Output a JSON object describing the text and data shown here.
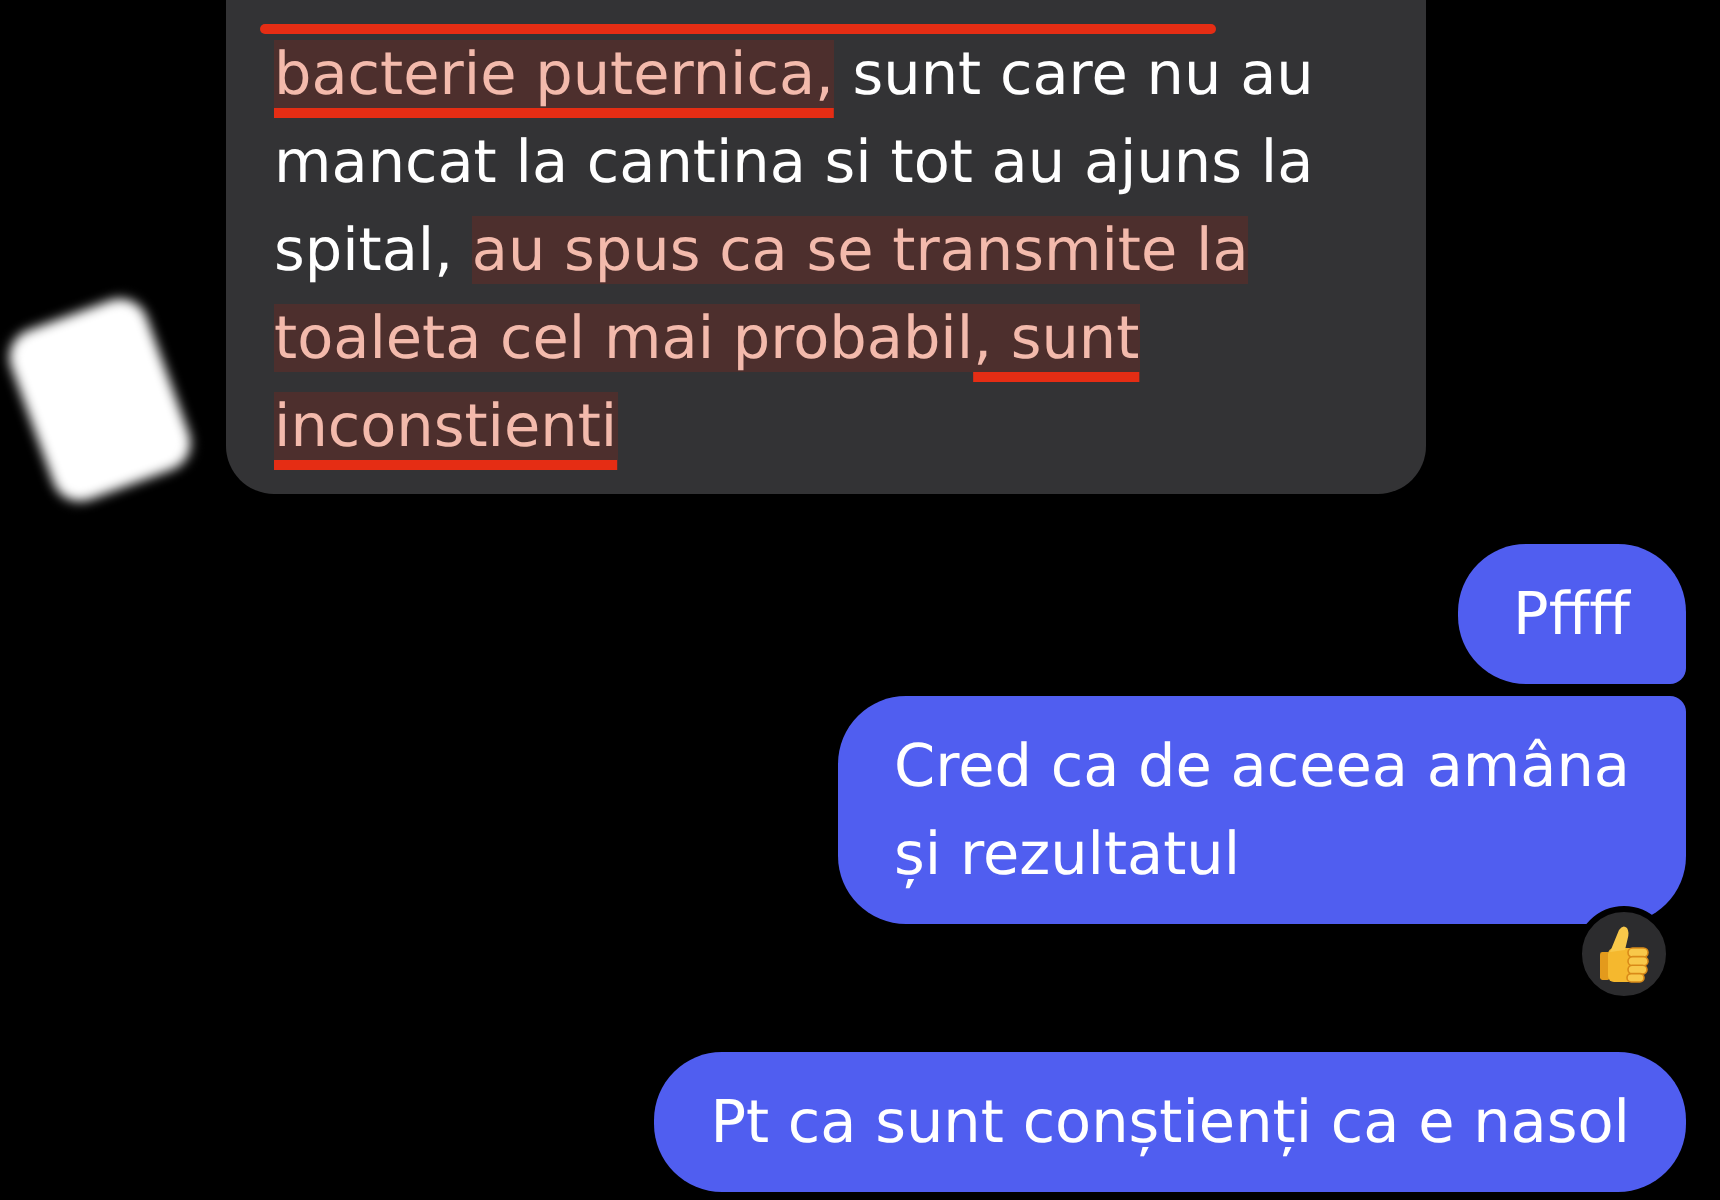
{
  "messages": [
    {
      "kind": "received",
      "continues": false,
      "liked": false,
      "segments": [
        {
          "text": "bacterie puternica,",
          "highlighted": true,
          "underlined": true
        },
        {
          "text": " sunt care nu au mancat la cantina si tot au ajuns la spital, ",
          "highlighted": false,
          "underlined": false
        },
        {
          "text": "au spus ca se transmite la toaleta cel mai probabil",
          "highlighted": true,
          "underlined": false
        },
        {
          "text": ", sunt inconstienti",
          "highlighted": true,
          "underlined": true
        }
      ]
    },
    {
      "kind": "sent",
      "continues": false,
      "liked": false,
      "text": "Pffff"
    },
    {
      "kind": "sent",
      "continues": true,
      "liked": true,
      "text": "Cred ca de aceea amâna\nși rezultatul"
    },
    {
      "kind": "sent",
      "continues": false,
      "liked": false,
      "text": "Pt ca sunt conștienți ca e nasol"
    }
  ]
}
